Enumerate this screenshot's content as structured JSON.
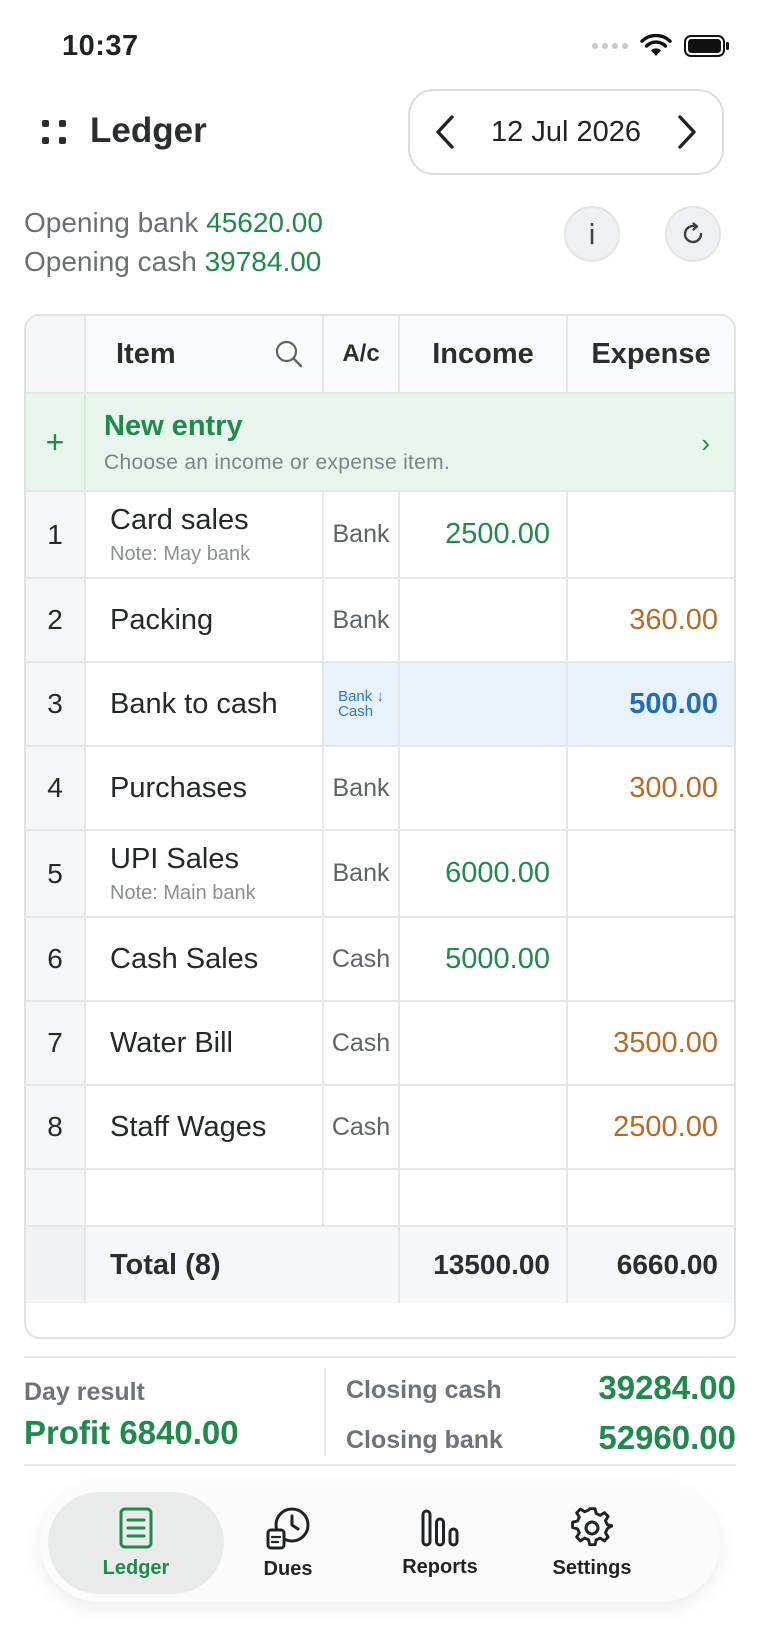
{
  "status": {
    "time": "10:37"
  },
  "header": {
    "title": "Ledger",
    "date": "12 Jul 2026"
  },
  "opening": {
    "bank_label": "Opening bank",
    "bank_value": "45620.00",
    "cash_label": "Opening cash",
    "cash_value": "39784.00",
    "info_label": "i"
  },
  "table": {
    "headers": {
      "item": "Item",
      "ac": "A/c",
      "income": "Income",
      "expense": "Expense"
    },
    "new_entry": {
      "plus": "+",
      "title": "New entry",
      "subtitle": "Choose an income or expense item.",
      "chevron": "›"
    },
    "rows": [
      {
        "num": "1",
        "item": "Card sales",
        "note": "Note: May bank",
        "ac": "Bank",
        "income": "2500.00",
        "expense": ""
      },
      {
        "num": "2",
        "item": "Packing",
        "note": "",
        "ac": "Bank",
        "income": "",
        "expense": "360.00"
      },
      {
        "num": "3",
        "item": "Bank to cash",
        "note": "",
        "ac_line1": "Bank ↓",
        "ac_line2": "Cash",
        "income": "",
        "expense": "500.00"
      },
      {
        "num": "4",
        "item": "Purchases",
        "note": "",
        "ac": "Bank",
        "income": "",
        "expense": "300.00"
      },
      {
        "num": "5",
        "item": "UPI Sales",
        "note": "Note: Main bank",
        "ac": "Bank",
        "income": "6000.00",
        "expense": ""
      },
      {
        "num": "6",
        "item": "Cash Sales",
        "note": "",
        "ac": "Cash",
        "income": "5000.00",
        "expense": ""
      },
      {
        "num": "7",
        "item": "Water Bill",
        "note": "",
        "ac": "Cash",
        "income": "",
        "expense": "3500.00"
      },
      {
        "num": "8",
        "item": "Staff Wages",
        "note": "",
        "ac": "Cash",
        "income": "",
        "expense": "2500.00"
      }
    ],
    "total": {
      "label": "Total (8)",
      "income": "13500.00",
      "expense": "6660.00"
    }
  },
  "summary": {
    "day_label": "Day result",
    "day_value": "Profit 6840.00",
    "closing_cash_label": "Closing cash",
    "closing_cash_value": "39284.00",
    "closing_bank_label": "Closing bank",
    "closing_bank_value": "52960.00"
  },
  "nav": {
    "ledger": "Ledger",
    "dues": "Dues",
    "reports": "Reports",
    "settings": "Settings"
  },
  "colors": {
    "accent_green": "#1f8a4c",
    "expense_orange": "#b86a24",
    "transfer_blue": "#1f6fb8"
  }
}
